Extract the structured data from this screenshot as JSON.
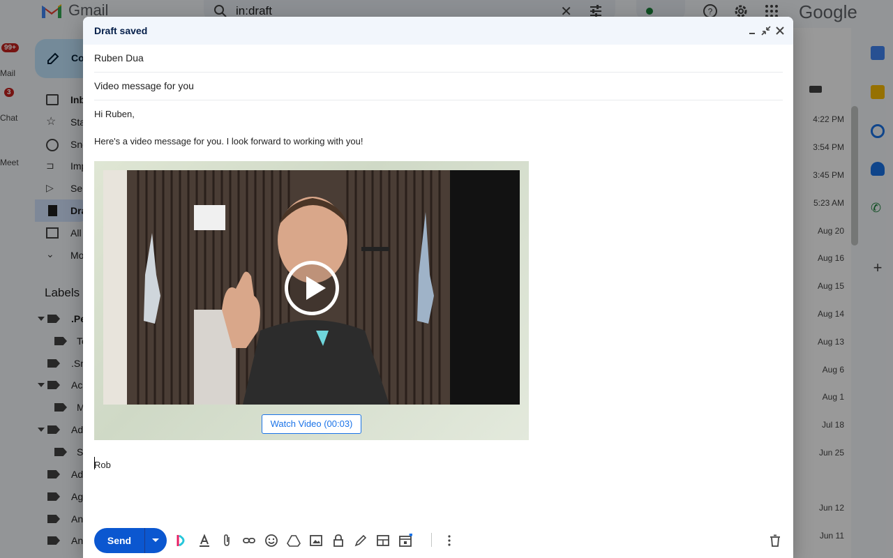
{
  "gmail": {
    "logo_text": "Gmail",
    "search_query": "in:draft",
    "google_text": "Google",
    "rail_badges": [
      "99+",
      "3"
    ],
    "rail_labels": [
      "Mail",
      "Chat",
      "Meet"
    ],
    "compose_label": "Compose",
    "nav": [
      "Inbox",
      "Starred",
      "Snoozed",
      "Important",
      "Sent",
      "Drafts",
      "All Mail",
      "More"
    ],
    "labels_title": "Labels",
    "labels": [
      ".Personal",
      "Te",
      ".Sn",
      "Ac",
      "M",
      "Ad",
      "S",
      "Ad",
      "Ag",
      "An",
      "An"
    ],
    "mail_dates": [
      "4:22 PM",
      "3:54 PM",
      "3:45 PM",
      "5:23 AM",
      "Aug 20",
      "Aug 16",
      "Aug 15",
      "Aug 14",
      "Aug 13",
      "Aug 6",
      "Aug 1",
      "Jul 18",
      "Jun 25",
      "Jun 12",
      "Jun 11"
    ]
  },
  "compose": {
    "title": "Draft saved",
    "to": "Ruben Dua",
    "subject": "Video message for you",
    "greeting": "Hi Ruben,",
    "paragraph": "Here's a video message for you. I look forward to working with you!",
    "watch_button": "Watch Video (00:03)",
    "signature": "Rob",
    "send_label": "Send"
  },
  "colors": {
    "accent": "#0b57d0",
    "link": "#1a73e8",
    "header_bg": "#f2f6fc",
    "badge": "#c5221f"
  }
}
